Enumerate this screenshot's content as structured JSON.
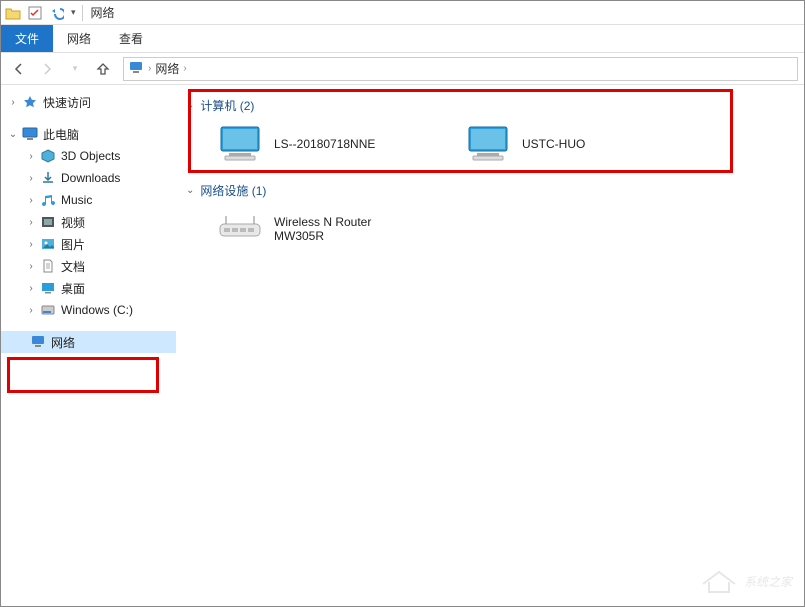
{
  "titlebar": {
    "title": "网络"
  },
  "ribbon": {
    "tabs": [
      {
        "label": "文件",
        "active": true
      },
      {
        "label": "网络",
        "active": false
      },
      {
        "label": "查看",
        "active": false
      }
    ]
  },
  "breadcrumb": {
    "root": "网络"
  },
  "sidebar": {
    "quick_access": "快速访问",
    "this_pc": "此电脑",
    "items": [
      {
        "label": "3D Objects"
      },
      {
        "label": "Downloads"
      },
      {
        "label": "Music"
      },
      {
        "label": "视频"
      },
      {
        "label": "图片"
      },
      {
        "label": "文档"
      },
      {
        "label": "桌面"
      },
      {
        "label": "Windows (C:)"
      }
    ],
    "network": "网络"
  },
  "content": {
    "group_computers": {
      "title": "计算机 (2)",
      "items": [
        {
          "label": "LS--20180718NNE"
        },
        {
          "label": "USTC-HUO"
        }
      ]
    },
    "group_devices": {
      "title": "网络设施 (1)",
      "items": [
        {
          "label_line1": "Wireless N Router",
          "label_line2": "MW305R"
        }
      ]
    }
  },
  "watermark": "系统之家"
}
